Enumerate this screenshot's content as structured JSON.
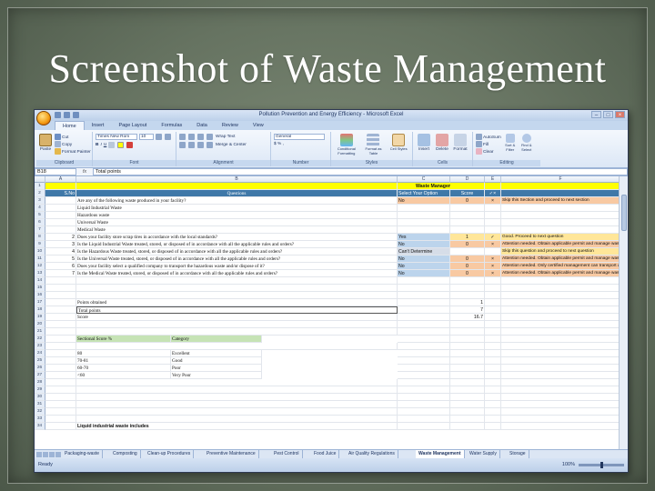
{
  "slide": {
    "title": "Screenshot of Waste Management"
  },
  "window": {
    "title": "Pollution Prevention and Energy Efficiency - Microsoft Excel",
    "controls": [
      "–",
      "□",
      "×"
    ]
  },
  "ribbon": {
    "tabs": [
      "Home",
      "Insert",
      "Page Layout",
      "Formulas",
      "Data",
      "Review",
      "View"
    ],
    "active_tab": "Home",
    "clipboard": {
      "paste": "Paste",
      "cut": "Cut",
      "copy": "Copy",
      "format_painter": "Format Painter",
      "label": "Clipboard"
    },
    "font": {
      "name": "Times New Rom",
      "size": "10",
      "label": "Font"
    },
    "alignment": {
      "wrap": "Wrap Text",
      "merge": "Merge & Center",
      "label": "Alignment"
    },
    "number": {
      "format": "General",
      "symbols": "$ % ,",
      "label": "Number"
    },
    "styles": {
      "conditional": "Conditional Formatting",
      "format_table": "Format as Table",
      "cell_styles": "Cell Styles",
      "label": "Styles"
    },
    "cells": {
      "insert": "Insert",
      "delete": "Delete",
      "format": "Format",
      "label": "Cells"
    },
    "editing": {
      "autosum": "AutoSum",
      "fill": "Fill",
      "clear": "Clear",
      "sort": "Sort & Filter",
      "find": "Find & Select",
      "label": "Editing"
    }
  },
  "formula_bar": {
    "name_box": "B18",
    "fx": "fx",
    "value": "Total points"
  },
  "columns": [
    "A",
    "B",
    "C",
    "D",
    "E",
    "F"
  ],
  "rows": [
    {
      "n": "1",
      "A": "",
      "B": "",
      "C": "Waste Management",
      "D": "",
      "E": "",
      "F": ""
    },
    {
      "n": "2",
      "A": "S.No",
      "B": "Questions",
      "C": "Select Your Option",
      "D": "Score",
      "E": "✓×",
      "F": ""
    },
    {
      "n": "3",
      "A": "",
      "B": "Are any of the following waste produced in your facility?",
      "C": "No",
      "D": "0",
      "E": "×",
      "F": "Skip this Section and proceed to next section"
    },
    {
      "n": "4",
      "A": "",
      "B": "Liquid Industrial Waste",
      "C": "",
      "D": "",
      "E": "",
      "F": ""
    },
    {
      "n": "5",
      "A": "",
      "B": "Hazardous waste",
      "C": "",
      "D": "",
      "E": "",
      "F": ""
    },
    {
      "n": "6",
      "A": "",
      "B": "Universal Waste",
      "C": "",
      "D": "",
      "E": "",
      "F": ""
    },
    {
      "n": "7",
      "A": "",
      "B": "Medical Waste",
      "C": "",
      "D": "",
      "E": "",
      "F": ""
    },
    {
      "n": "8",
      "A": "2",
      "B": "Does your facility store scrap tires in accordance with the local standards?",
      "C": "Yes",
      "D": "1",
      "E": "✓",
      "F": "Good. Proceed to next question"
    },
    {
      "n": "9",
      "A": "3",
      "B": "Is the Liquid Industrial Waste treated, stored, or disposed of in accordance with all the applicable rules and orders?",
      "C": "No",
      "D": "0",
      "E": "×",
      "F": "Attention needed. Obtain applicable permit and manage waste appro"
    },
    {
      "n": "10",
      "A": "4",
      "B": "Is the Hazardous Waste treated, stored, or disposed of in accordance with all the applicable rules and orders?",
      "C": "Can't Determine",
      "D": "",
      "E": "",
      "F": "Skip this question and proceed to next question"
    },
    {
      "n": "11",
      "A": "5",
      "B": "Is the Universal Waste treated, stored, or disposed of in accordance with all the applicable rules and orders?",
      "C": "No",
      "D": "0",
      "E": "×",
      "F": "Attention needed. Obtain applicable permit and manage waste appro"
    },
    {
      "n": "12",
      "A": "6",
      "B": "Does your facility select a qualified company to transport the hazardous waste and/or dispose of it?",
      "C": "No",
      "D": "0",
      "E": "×",
      "F": "Attention needed. Only certified management can transport and disp"
    },
    {
      "n": "13",
      "A": "7",
      "B": "Is the Medical Waste treated, stored, or disposed of in accordance with all the applicable rules and orders?",
      "C": "No",
      "D": "0",
      "E": "×",
      "F": "Attention needed. Obtain applicable permit and manage waste appro"
    },
    {
      "n": "14",
      "A": "",
      "B": "",
      "C": "",
      "D": "",
      "E": "",
      "F": ""
    },
    {
      "n": "15",
      "A": "",
      "B": "",
      "C": "",
      "D": "",
      "E": "",
      "F": ""
    },
    {
      "n": "16",
      "A": "",
      "B": "",
      "C": "",
      "D": "",
      "E": "",
      "F": ""
    },
    {
      "n": "17",
      "A": "",
      "B": "Points obtained",
      "C": "",
      "D": "1",
      "E": "",
      "F": ""
    },
    {
      "n": "18",
      "A": "",
      "B": "Total points",
      "C": "",
      "D": "7",
      "E": "",
      "F": ""
    },
    {
      "n": "19",
      "A": "",
      "B": "Score",
      "C": "",
      "D": "16.7",
      "E": "",
      "F": ""
    },
    {
      "n": "20",
      "A": "",
      "B": "",
      "C": "",
      "D": "",
      "E": "",
      "F": ""
    },
    {
      "n": "21",
      "A": "",
      "B": "",
      "C": "",
      "D": "",
      "E": "",
      "F": ""
    },
    {
      "n": "22",
      "A": "",
      "B": "Sectional Score %",
      "B2": "Category",
      "C": "",
      "D": "",
      "E": "",
      "F": ""
    },
    {
      "n": "23",
      "A": "",
      "B": "",
      "C": "",
      "D": "",
      "E": "",
      "F": ""
    },
    {
      "n": "24",
      "A": "",
      "B": "80",
      "B2": "Excellent",
      "C": "",
      "D": "",
      "E": "",
      "F": ""
    },
    {
      "n": "25",
      "A": "",
      "B": "70-81",
      "B2": "Good",
      "C": "",
      "D": "",
      "E": "",
      "F": ""
    },
    {
      "n": "26",
      "A": "",
      "B": "60-70",
      "B2": "Poor",
      "C": "",
      "D": "",
      "E": "",
      "F": ""
    },
    {
      "n": "27",
      "A": "",
      "B": "<60",
      "B2": "Very Poor",
      "C": "",
      "D": "",
      "E": "",
      "F": ""
    },
    {
      "n": "28",
      "A": "",
      "B": "",
      "C": "",
      "D": "",
      "E": "",
      "F": ""
    },
    {
      "n": "29",
      "A": "",
      "B": "",
      "C": "",
      "D": "",
      "E": "",
      "F": ""
    },
    {
      "n": "30",
      "A": "",
      "B": "",
      "C": "",
      "D": "",
      "E": "",
      "F": ""
    },
    {
      "n": "31",
      "A": "",
      "B": "",
      "C": "",
      "D": "",
      "E": "",
      "F": ""
    },
    {
      "n": "32",
      "A": "",
      "B": "",
      "C": "",
      "D": "",
      "E": "",
      "F": ""
    },
    {
      "n": "33",
      "A": "",
      "B": "",
      "C": "",
      "D": "",
      "E": "",
      "F": ""
    },
    {
      "n": "34",
      "A": "",
      "B": "Liquid industrial waste includes",
      "C": "",
      "D": "",
      "E": "",
      "F": ""
    }
  ],
  "sheet_tabs": [
    "Packaging-waste",
    "Composting",
    "Clean-up Procedures",
    "Preventive Maintenance",
    "Pest Control",
    "Food Juice",
    "Air Quality Regulations",
    "Waste Management",
    "Water Supply",
    "Storage"
  ],
  "active_sheet": "Waste Management",
  "status": {
    "ready": "Ready",
    "zoom": "100%"
  },
  "colors": {
    "header_yellow": "#ffff00",
    "header_blue": "#3f78a8",
    "answer_blue": "#bcd4ec",
    "feedback_orange": "#f8c9a2",
    "section_green": "#c6e3b5"
  }
}
